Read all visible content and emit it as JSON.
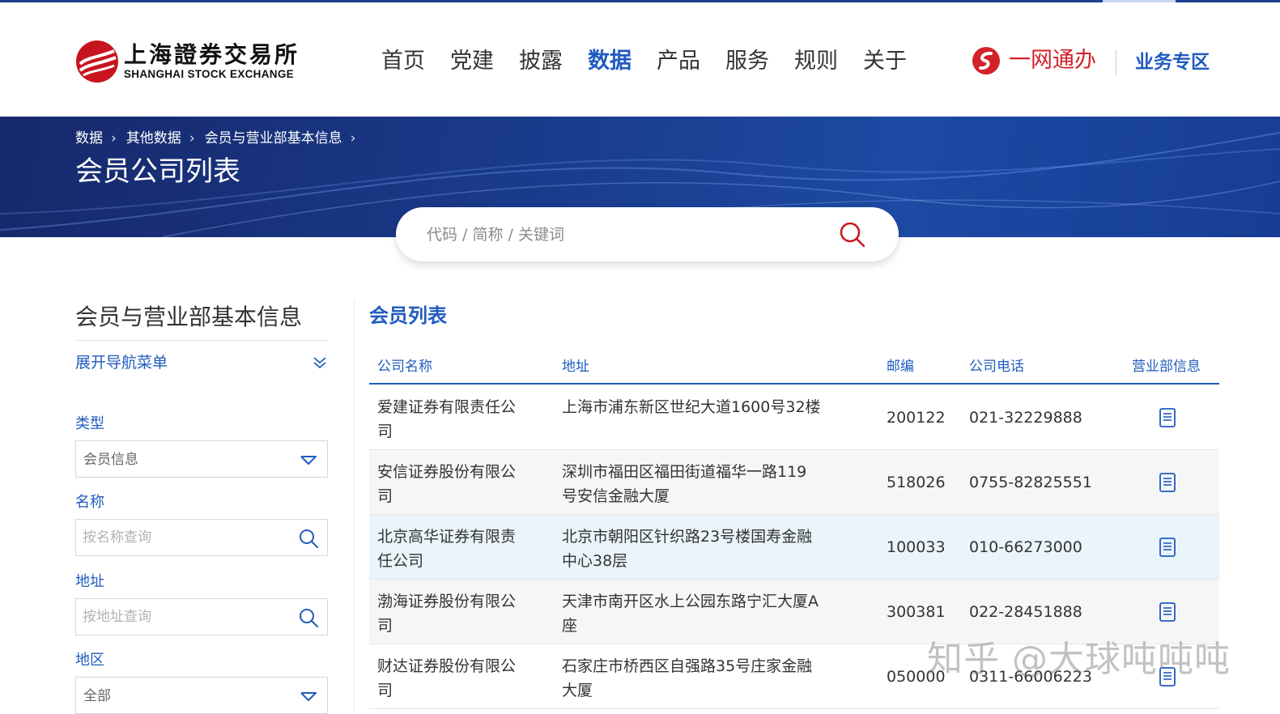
{
  "header": {
    "logo_cn": "上海證券交易所",
    "logo_en": "SHANGHAI STOCK EXCHANGE",
    "nav": [
      "首页",
      "党建",
      "披露",
      "数据",
      "产品",
      "服务",
      "规则",
      "关于"
    ],
    "active_nav": "数据",
    "yiwang_label": "一网通办",
    "biz_zone": "业务专区"
  },
  "banner": {
    "breadcrumb": [
      "数据",
      "其他数据",
      "会员与营业部基本信息"
    ],
    "title": "会员公司列表"
  },
  "search": {
    "placeholder": "代码 / 简称 / 关键词",
    "icon": "search-icon"
  },
  "sidebar": {
    "title": "会员与营业部基本信息",
    "expand_label": "展开导航菜单",
    "filters": {
      "type_label": "类型",
      "type_value": "会员信息",
      "name_label": "名称",
      "name_placeholder": "按名称查询",
      "address_label": "地址",
      "address_placeholder": "按地址查询",
      "region_label": "地区",
      "region_value": "全部"
    }
  },
  "table": {
    "title": "会员列表",
    "columns": [
      "公司名称",
      "地址",
      "邮编",
      "公司电话",
      "营业部信息"
    ],
    "rows": [
      {
        "name": "爱建证券有限责任公司",
        "address": "上海市浦东新区世纪大道1600号32楼",
        "zip": "200122",
        "tel": "021-32229888"
      },
      {
        "name": "安信证券股份有限公司",
        "address": "深圳市福田区福田街道福华一路119号安信金融大厦",
        "zip": "518026",
        "tel": "0755-82825551"
      },
      {
        "name": "北京高华证券有限责任公司",
        "address": "北京市朝阳区针织路23号楼国寿金融中心38层",
        "zip": "100033",
        "tel": "010-66273000"
      },
      {
        "name": "渤海证券股份有限公司",
        "address": "天津市南开区水上公园东路宁汇大厦A座",
        "zip": "300381",
        "tel": "022-28451888"
      },
      {
        "name": "财达证券股份有限公司",
        "address": "石家庄市桥西区自强路35号庄家金融大厦",
        "zip": "050000",
        "tel": "0311-66006223"
      }
    ]
  },
  "watermark": "知乎 @大球吨吨吨",
  "colors": {
    "brand_blue": "#1f5bbf",
    "brand_red": "#d3222a",
    "banner_dark": "#16286b",
    "highlight_row": "#eaf4fb"
  }
}
